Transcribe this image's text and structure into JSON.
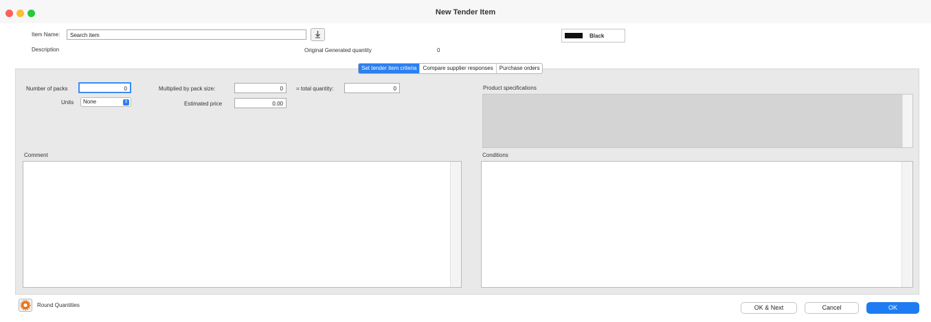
{
  "window": {
    "title": "New Tender Item"
  },
  "item": {
    "name_label": "Item Name:",
    "name_value": "Search item",
    "description_label": "Description"
  },
  "original_quantity": {
    "label": "Original Generated quantity",
    "value": "0"
  },
  "color_swatch": {
    "label": "Black",
    "color": "#111111"
  },
  "tabs": [
    {
      "label": "Set tender item criteria",
      "active": true
    },
    {
      "label": "Compare supplier responses",
      "active": false
    },
    {
      "label": "Purchase orders",
      "active": false
    }
  ],
  "criteria": {
    "number_of_packs_label": "Number of packs",
    "number_of_packs_value": "0",
    "units_label": "Units",
    "units_value": "None",
    "pack_size_label": "Multiplied by pack size:",
    "pack_size_value": "0",
    "total_quantity_label": "= total quantity:",
    "total_quantity_value": "0",
    "estimated_price_label": "Estimated price",
    "estimated_price_value": "0.00"
  },
  "sections": {
    "product_specifications_label": "Product specifications",
    "comment_label": "Comment",
    "conditions_label": "Conditions"
  },
  "footer": {
    "round_quantities_label": "Round Quantities",
    "ok_next_label": "OK & Next",
    "cancel_label": "Cancel",
    "ok_label": "OK"
  },
  "colors": {
    "accent": "#1e7cf2",
    "close": "#fe5f57",
    "minimize": "#febc2e",
    "zoom": "#28c840"
  }
}
